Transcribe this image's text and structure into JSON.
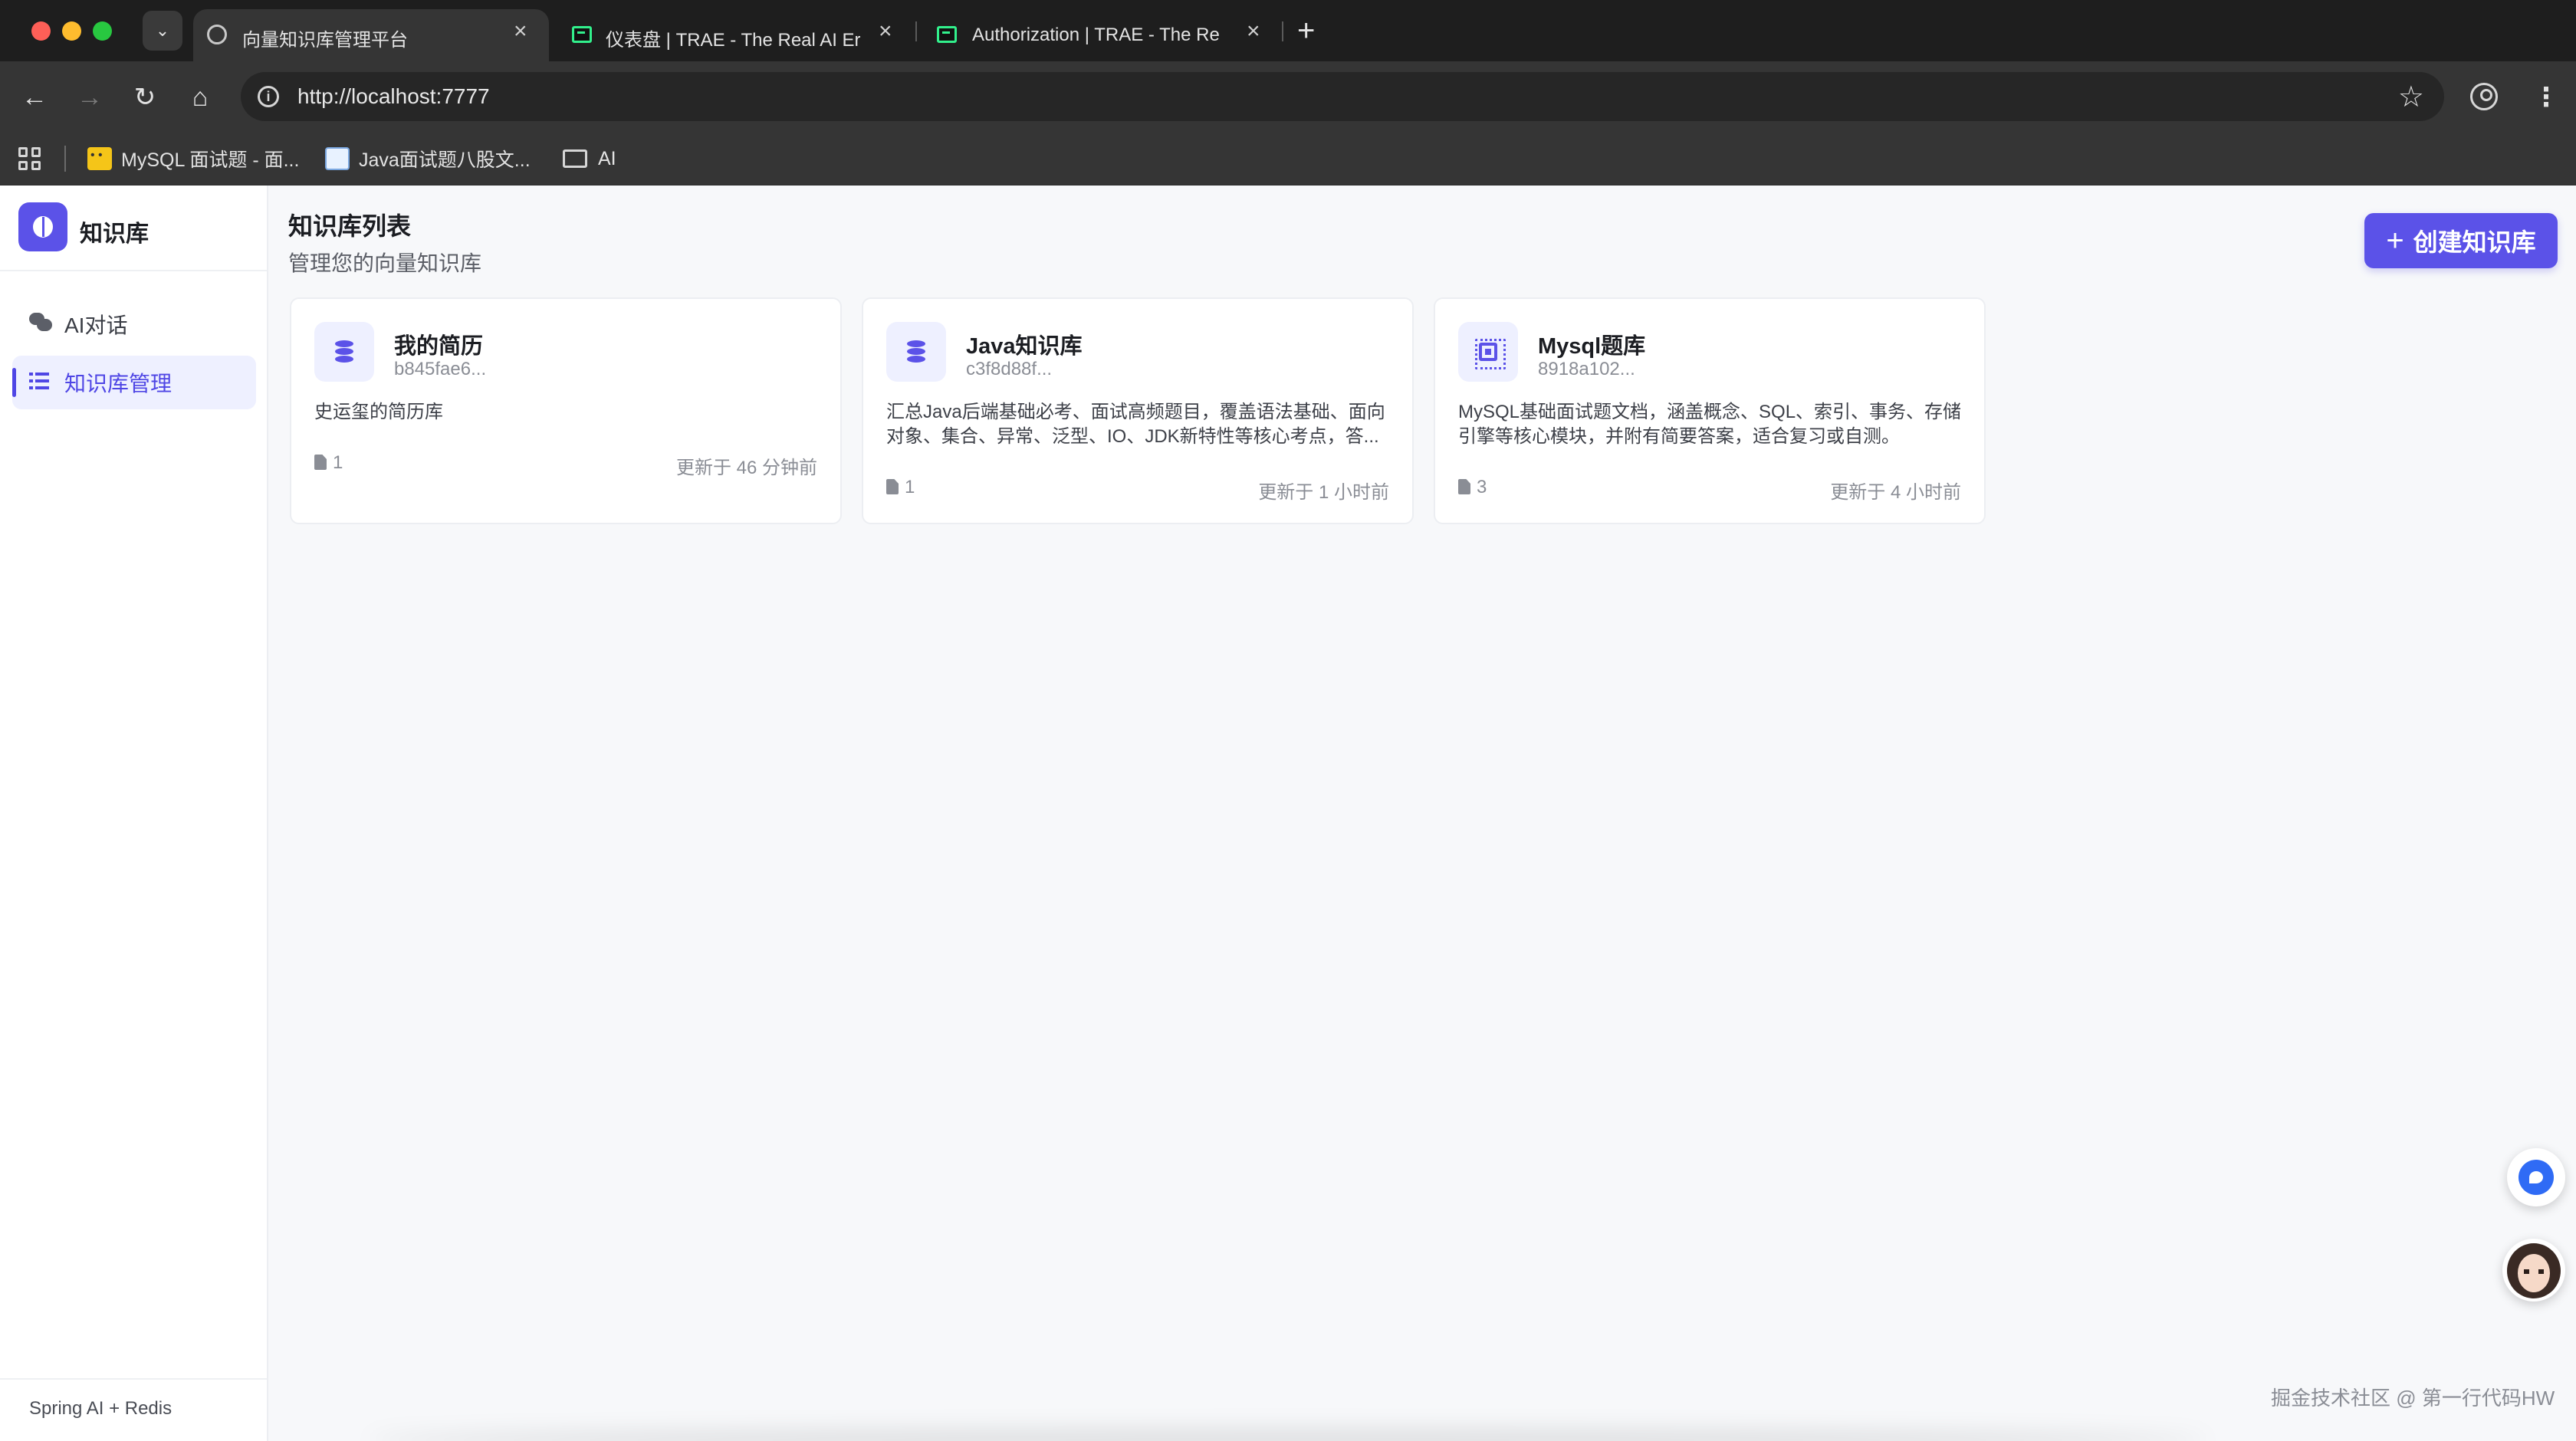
{
  "browser": {
    "tabs": [
      {
        "title": "向量知识库管理平台",
        "active": true
      },
      {
        "title": "仪表盘 | TRAE - The Real AI Er",
        "active": false
      },
      {
        "title": "Authorization | TRAE - The Re",
        "active": false
      }
    ],
    "tab_close": "×",
    "new_tab": "+",
    "url": "http://localhost:7777",
    "bookmarks": [
      {
        "label": "MySQL 面试题 - 面..."
      },
      {
        "label": "Java面试题八股文..."
      },
      {
        "label": "AI"
      }
    ]
  },
  "sidebar": {
    "brand": "知识库",
    "items": [
      {
        "label": "AI对话",
        "icon": "chat-icon",
        "active": false
      },
      {
        "label": "知识库管理",
        "icon": "list-icon",
        "active": true
      }
    ],
    "footer": "Spring AI + Redis"
  },
  "main": {
    "title": "知识库列表",
    "subtitle": "管理您的向量知识库",
    "create_button": "创建知识库",
    "create_icon": "+",
    "cards": [
      {
        "name": "我的简历",
        "id": "b845fae6...",
        "description": "史运玺的简历库",
        "doc_count": "1",
        "updated": "更新于 46 分钟前",
        "icon": "database-icon"
      },
      {
        "name": "Java知识库",
        "id": "c3f8d88f...",
        "description": "汇总Java后端基础必考、面试高频题目，覆盖语法基础、面向对象、集合、异常、泛型、IO、JDK新特性等核心考点，答...",
        "doc_count": "1",
        "updated": "更新于 1 小时前",
        "icon": "database-icon"
      },
      {
        "name": "Mysql题库",
        "id": "8918a102...",
        "description": "MySQL基础面试题文档，涵盖概念、SQL、索引、事务、存储引擎等核心模块，并附有简要答案，适合复习或自测。",
        "doc_count": "3",
        "updated": "更新于 4 小时前",
        "icon": "chip-icon"
      }
    ]
  },
  "watermark": "掘金技术社区 @ 第一行代码HW",
  "colors": {
    "accent": "#5b52e8",
    "active_bg": "#eef0ff",
    "page_bg": "#f7f8fa"
  }
}
